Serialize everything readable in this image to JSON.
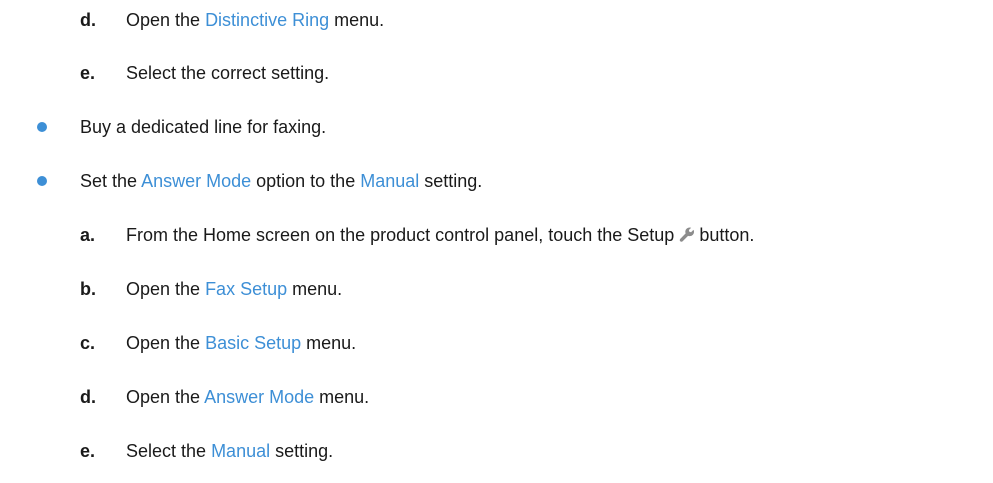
{
  "steps_top": [
    {
      "marker": "d.",
      "pre": "Open the ",
      "ui": "Distinctive Ring",
      "post": " menu."
    },
    {
      "marker": "e.",
      "text": "Select the correct setting."
    }
  ],
  "bullets": [
    {
      "text": "Buy a dedicated line for faxing."
    },
    {
      "pre": "Set the ",
      "ui1": "Answer Mode",
      "mid": " option to the ",
      "ui2": "Manual",
      "post": " setting."
    }
  ],
  "steps_bottom": [
    {
      "marker": "a.",
      "pre": "From the Home screen on the product control panel, touch the Setup",
      "icon": "wrench-icon",
      "post": "button."
    },
    {
      "marker": "b.",
      "pre": "Open the ",
      "ui": "Fax Setup",
      "post": " menu."
    },
    {
      "marker": "c.",
      "pre": "Open the ",
      "ui": "Basic Setup",
      "post": " menu."
    },
    {
      "marker": "d.",
      "pre": "Open the ",
      "ui": "Answer Mode",
      "post": " menu."
    },
    {
      "marker": "e.",
      "pre": "Select the ",
      "ui": "Manual",
      "post": " setting."
    }
  ],
  "colors": {
    "ui_text": "#3d8fd6",
    "bullet": "#3d8fd6",
    "body_text": "#1a1a1a"
  }
}
